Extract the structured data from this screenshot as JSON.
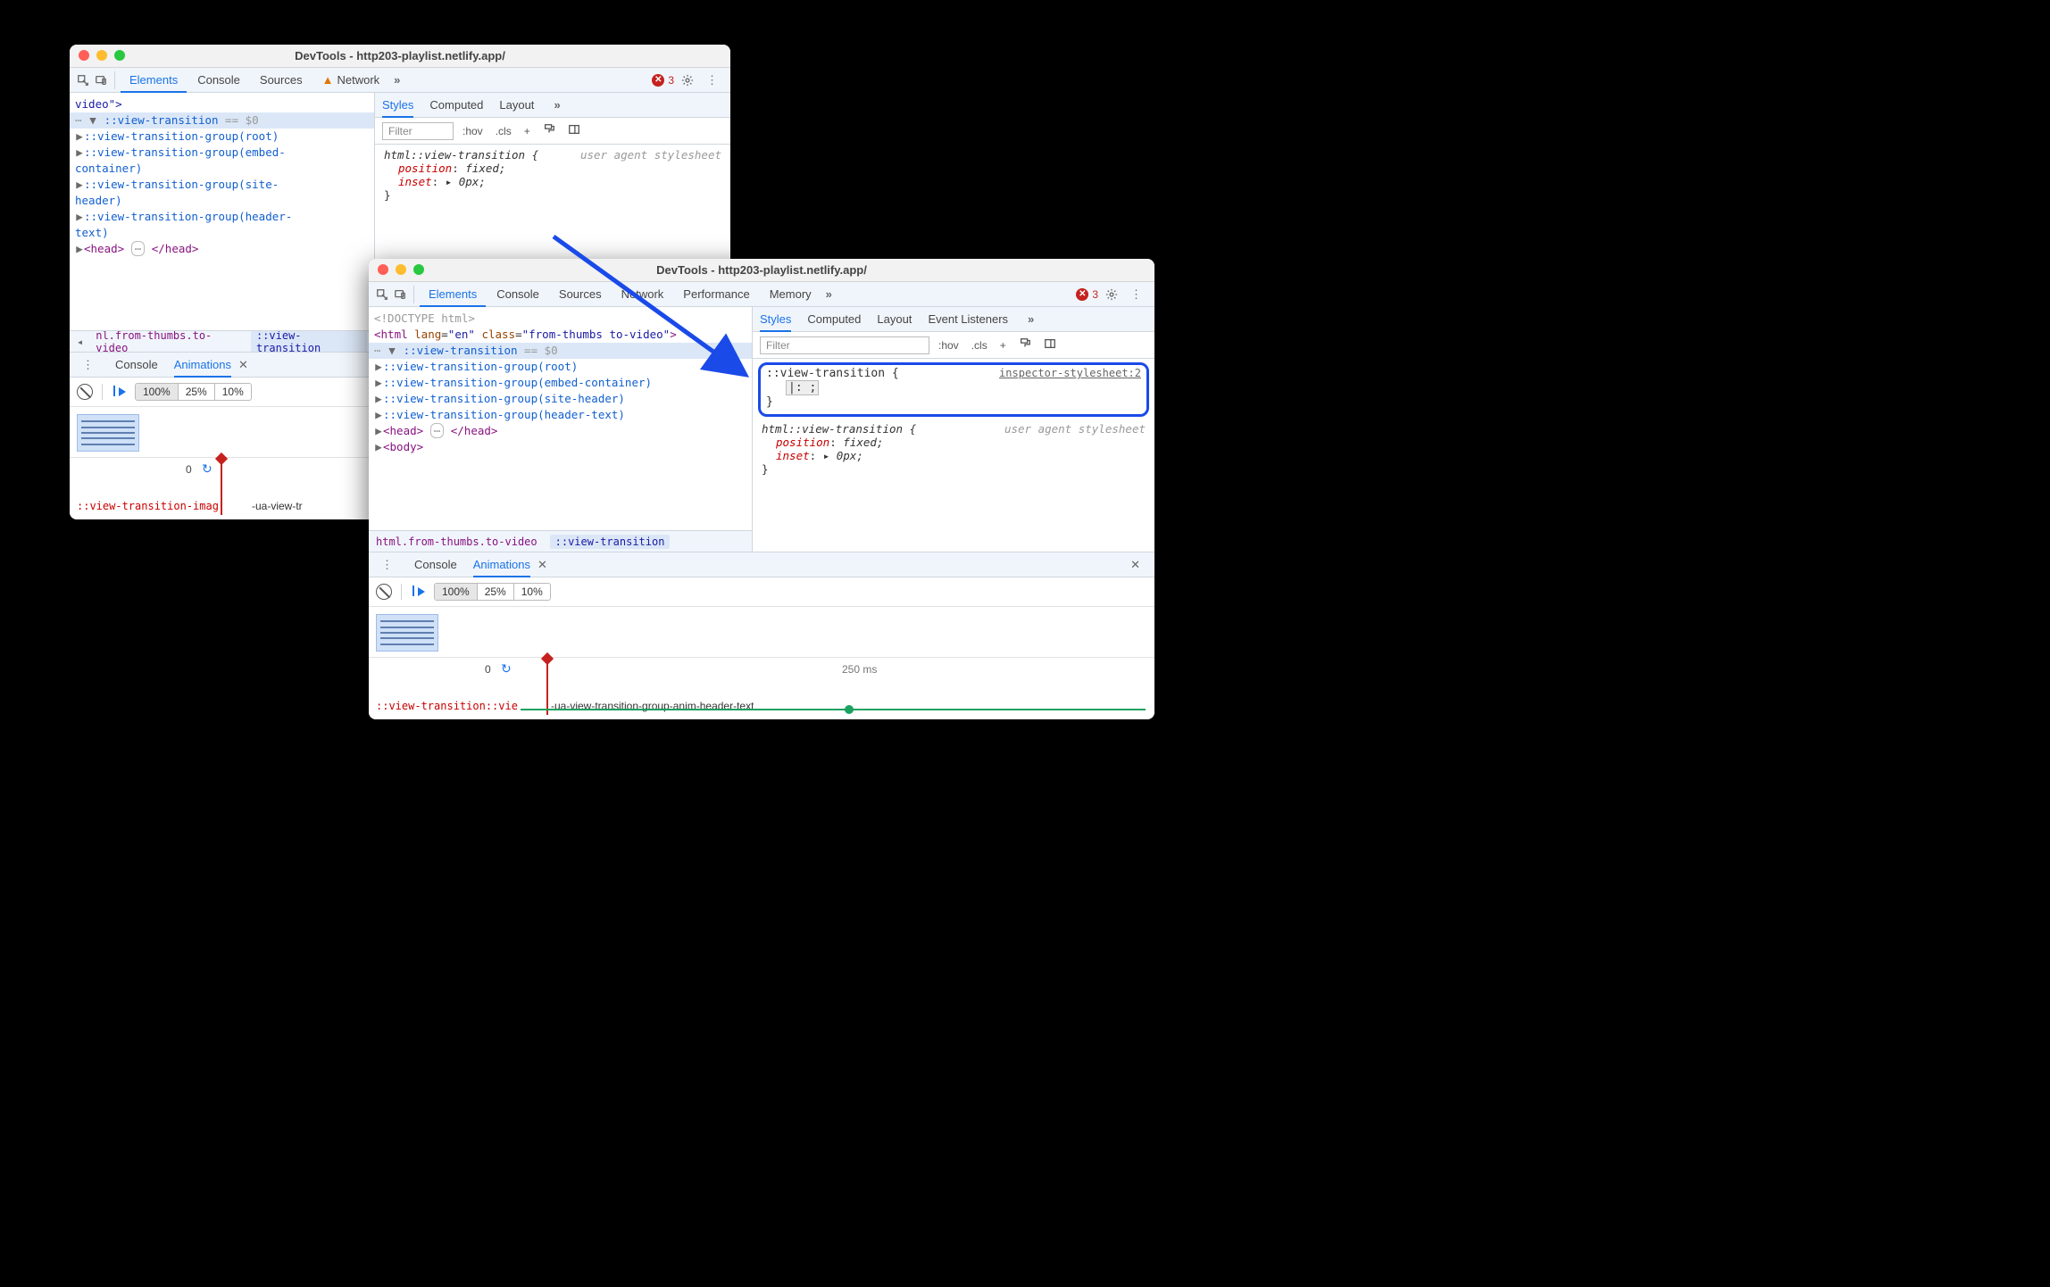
{
  "window_title": "DevTools - http203-playlist.netlify.app/",
  "traffic_lights": [
    "red",
    "yellow",
    "green"
  ],
  "tabs_win1": [
    "Elements",
    "Console",
    "Sources",
    "Network"
  ],
  "tabs_win2": [
    "Elements",
    "Console",
    "Sources",
    "Network",
    "Performance",
    "Memory"
  ],
  "tabs_active_index": 0,
  "network_warning": true,
  "overflow_label": "»",
  "error_count": "3",
  "error_x_symbol": "✕",
  "kebab": "⋮",
  "styles_subtabs_win1": [
    "Styles",
    "Computed",
    "Layout"
  ],
  "styles_subtabs_win2": [
    "Styles",
    "Computed",
    "Layout",
    "Event Listeners"
  ],
  "styles_active_index": 0,
  "filter_placeholder": "Filter",
  "styles_toolbar": {
    "hov": ":hov",
    "cls": ".cls",
    "plus": "+"
  },
  "ua_label": "user agent stylesheet",
  "inspector_src": "inspector-stylesheet:2",
  "rule1": {
    "selector": "html::view-transition {",
    "props": [
      {
        "n": "position",
        "v": "fixed;"
      },
      {
        "n": "inset",
        "v": "▸ 0px;"
      }
    ],
    "close": "}"
  },
  "rule_highlight": {
    "selector": "::view-transition {",
    "editing": "|:  ;",
    "close": "}"
  },
  "tree_win1": {
    "ln0": "video\">",
    "sel": "::view-transition",
    "sel_suffix": " == $0",
    "dots": "⋯",
    "group_root": "::view-transition-group(root)",
    "group_embed1": "::view-transition-group(embed-",
    "group_embed2": "container)",
    "group_site1": "::view-transition-group(site-",
    "group_site2": "header)",
    "group_header1": "::view-transition-group(header-",
    "group_header2": "text)",
    "head_open": "<head>",
    "head_close": "</head>",
    "head_dots": "⋯"
  },
  "tree_win2": {
    "doctype": "<!DOCTYPE html>",
    "html_open_1": "<html ",
    "lang_n": "lang",
    "lang_v": "\"en\"",
    "class_n": "class",
    "class_v": "\"from-thumbs to-video\"",
    "html_open_end": ">",
    "sel": "::view-transition",
    "sel_suffix": " == $0",
    "group_root": "::view-transition-group(root)",
    "group_embed": "::view-transition-group(embed-container)",
    "group_site": "::view-transition-group(site-header)",
    "group_header": "::view-transition-group(header-text)",
    "head_open": "<head>",
    "head_close": "</head>",
    "head_dots": "⋯",
    "body_open": "<body>"
  },
  "crumbs_win1": {
    "left_chev": "◂",
    "c0": "nl.from-thumbs.to-video",
    "c1": "::view-transition"
  },
  "crumbs_win2": {
    "c0": "html.from-thumbs.to-video",
    "c1": "::view-transition"
  },
  "drawer_tabs": [
    "Console",
    "Animations"
  ],
  "drawer_active_index": 1,
  "drawer_close": "✕",
  "speed_options": [
    "100%",
    "25%",
    "10%"
  ],
  "timeline_zero": "0",
  "refresh_glyph": "↻",
  "track_label_win1": "::view-transition-imag",
  "track_name_win1": "-ua-view-tr",
  "track_label_win2": "::view-transition::vie",
  "track_name_win2": "-ua-view-transition-group-anim-header-text",
  "ms250": "250 ms"
}
